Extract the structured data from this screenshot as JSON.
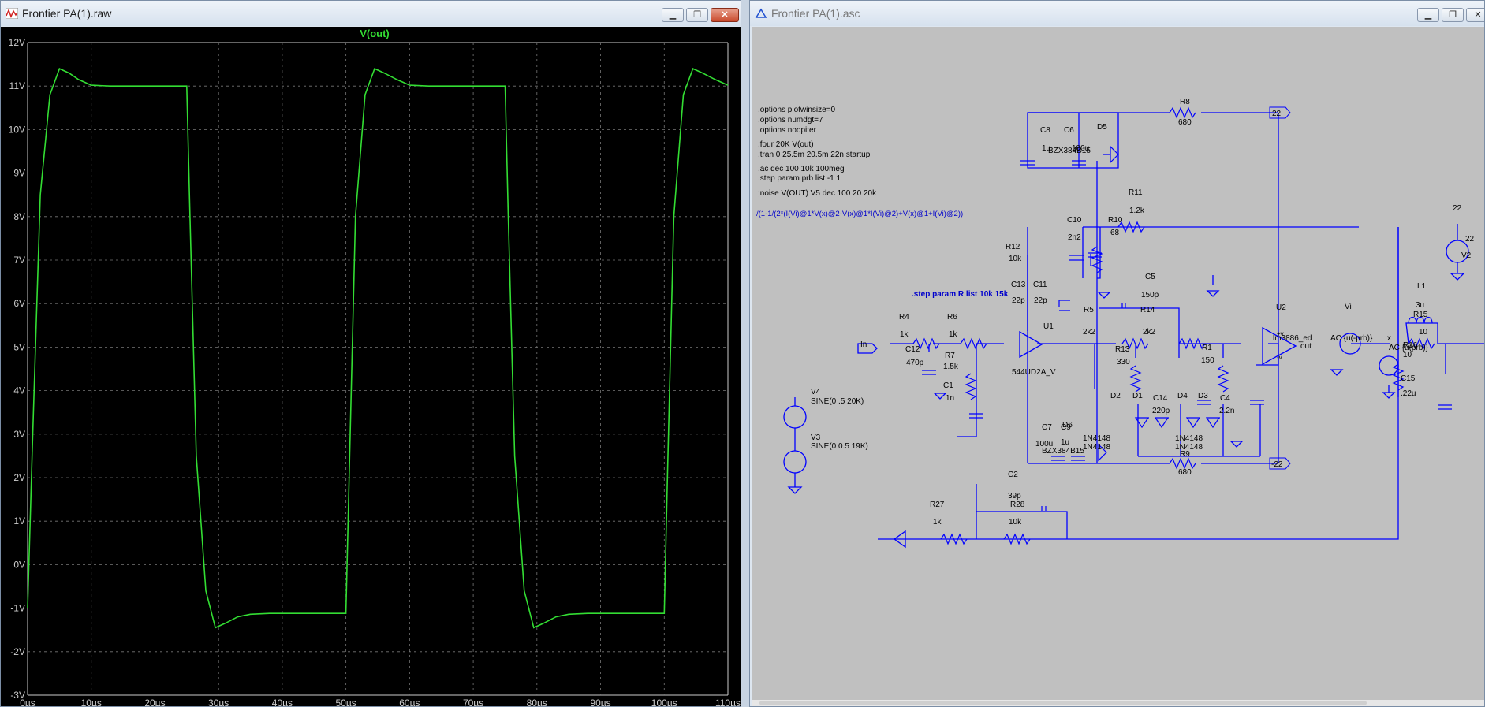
{
  "plot_window": {
    "title": "Frontier PA(1).raw",
    "trace_label": "V(out)",
    "trace_color": "#33dd33",
    "axis_color": "#cccccc",
    "chart_data": {
      "type": "line",
      "title": "V(out)",
      "xlabel": "",
      "ylabel": "",
      "ylim": [
        -3,
        12
      ],
      "xlim": [
        0,
        110
      ],
      "y_ticks": [
        "12V",
        "11V",
        "10V",
        "9V",
        "8V",
        "7V",
        "6V",
        "5V",
        "4V",
        "3V",
        "2V",
        "1V",
        "0V",
        "-1V",
        "-2V",
        "-3V"
      ],
      "x_ticks": [
        "0µs",
        "10µs",
        "20µs",
        "30µs",
        "40µs",
        "50µs",
        "60µs",
        "70µs",
        "80µs",
        "90µs",
        "100µs",
        "110µs"
      ],
      "grid": true,
      "series": [
        {
          "name": "V(out)",
          "x": [
            0,
            0.8,
            2,
            3.5,
            5,
            6.5,
            8,
            10,
            13,
            16,
            25,
            25.5,
            26.5,
            28,
            29.5,
            31,
            33,
            35,
            38,
            42,
            50,
            50.5,
            51.5,
            53,
            54.5,
            56,
            58,
            60,
            63,
            67,
            75,
            75.5,
            76.5,
            78,
            79.5,
            81,
            83,
            85,
            88,
            92,
            100,
            100.5,
            101.5,
            103,
            104.5,
            106,
            108,
            110
          ],
          "y": [
            -1,
            3,
            8.5,
            10.8,
            11.4,
            11.3,
            11.15,
            11.02,
            11,
            11,
            11,
            8,
            2.5,
            -0.6,
            -1.45,
            -1.35,
            -1.2,
            -1.14,
            -1.12,
            -1.12,
            -1.12,
            2,
            8,
            10.8,
            11.4,
            11.3,
            11.15,
            11.02,
            11,
            11,
            11,
            8,
            2.5,
            -0.6,
            -1.45,
            -1.35,
            -1.2,
            -1.14,
            -1.12,
            -1.12,
            -1.12,
            2,
            8,
            10.8,
            11.4,
            11.3,
            11.15,
            11.02
          ]
        }
      ]
    }
  },
  "schematic_window": {
    "title": "Frontier PA(1).asc",
    "wire_color": "#0000ff",
    "directives": [
      ".options plotwinsize=0",
      ".options numdgt=7",
      ".options noopiter",
      ".four 20K V(out)",
      ".tran 0 25.5m 20.5m 22n startup",
      ".ac dec 100 10k 100meg",
      ".step param prb list -1 1",
      ";noise V(OUT) V5 dec 100 20 20k",
      "/(1-1/(2*(I(Vi)@1*V(x)@2-V(x)@1*I(Vi)@2)+V(x)@1+I(Vi)@2))"
    ],
    "step_directive": ".step param R list 10k 15k",
    "components": [
      {
        "ref": "R8",
        "value": "680"
      },
      {
        "ref": "C8",
        "value": "1u"
      },
      {
        "ref": "C6",
        "value": "100u"
      },
      {
        "ref": "D5",
        "value": "BZX384B15"
      },
      {
        "ref": "R11",
        "value": "1.2k"
      },
      {
        "ref": "C10",
        "value": "2n2"
      },
      {
        "ref": "R10",
        "value": "68"
      },
      {
        "ref": "R12",
        "value": "10k"
      },
      {
        "ref": "C13",
        "value": "22p"
      },
      {
        "ref": "C11",
        "value": "22p"
      },
      {
        "ref": "C5",
        "value": "150p"
      },
      {
        "ref": "R4",
        "value": "1k"
      },
      {
        "ref": "R6",
        "value": "1k"
      },
      {
        "ref": "U1",
        "value": "544UD2A_V"
      },
      {
        "ref": "R5",
        "value": "2k2"
      },
      {
        "ref": "R14",
        "value": "2k2"
      },
      {
        "ref": "U2",
        "value": "lm3886_ed"
      },
      {
        "ref": "Vi",
        "value": "AC {u(-prb)}"
      },
      {
        "ref": "L1",
        "value": "3u"
      },
      {
        "ref": "R15",
        "value": "10"
      },
      {
        "ref": "R16",
        "value": "10"
      },
      {
        "ref": "C15",
        "value": ".22u"
      },
      {
        "ref": "C12",
        "value": "470p"
      },
      {
        "ref": "R7",
        "value": "1.5k"
      },
      {
        "ref": "C1",
        "value": "1n"
      },
      {
        "ref": "R13",
        "value": "330"
      },
      {
        "ref": "R1",
        "value": "150"
      },
      {
        "ref": "C14",
        "value": "220p"
      },
      {
        "ref": "C4",
        "value": "2.2n"
      },
      {
        "ref": "D2",
        "value": "1N4148"
      },
      {
        "ref": "D1",
        "value": "1N4148"
      },
      {
        "ref": "D4",
        "value": "1N4148"
      },
      {
        "ref": "D3",
        "value": "1N4148"
      },
      {
        "ref": "C7",
        "value": "100u"
      },
      {
        "ref": "C9",
        "value": "1u"
      },
      {
        "ref": "D6",
        "value": "BZX384B15"
      },
      {
        "ref": "R9",
        "value": "680"
      },
      {
        "ref": "C2",
        "value": "39p"
      },
      {
        "ref": "R27",
        "value": "1k"
      },
      {
        "ref": "R28",
        "value": "10k"
      },
      {
        "ref": "V4",
        "value": "SINE(0 .5 20K)"
      },
      {
        "ref": "V3",
        "value": "SINE(0 0.5 19K)"
      },
      {
        "ref": "V2",
        "value": "22"
      }
    ],
    "net_labels": [
      "In",
      "22",
      "-22",
      "22",
      "out",
      "x"
    ],
    "pin_labels": [
      "+v",
      "-v"
    ],
    "source_ac": "AC {u(prb)}",
    "d6_value": "1N4148"
  },
  "controls": {
    "minimize": "▁",
    "maximize": "❐",
    "close": "✕"
  }
}
